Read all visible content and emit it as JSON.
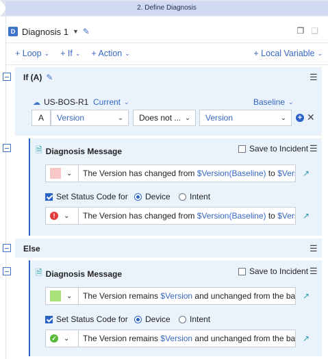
{
  "step": {
    "label": "2. Define Diagnosis"
  },
  "diagnosis": {
    "badge": "D",
    "title": "Diagnosis 1"
  },
  "toolbar": {
    "loop": "+ Loop",
    "if": "+ If",
    "action": "+ Action",
    "local_variable": "+ Local Variable"
  },
  "if_block": {
    "title": "If (A)",
    "device": "US-BOS-R1",
    "current": "Current",
    "baseline": "Baseline",
    "condition": {
      "letter": "A",
      "variable": "Version",
      "operator": "Does not ...",
      "value": "Version"
    }
  },
  "msg1": {
    "title": "Diagnosis Message",
    "save_to_incident": "Save to Incident",
    "color": "#f8c8c8",
    "text_prefix": "The Version has changed from ",
    "var1": "$Version(Baseline)",
    "mid": " to ",
    "var2": "$Version",
    "set_status": "Set Status Code for",
    "device": "Device",
    "intent": "Intent",
    "status_icon": "error-icon",
    "status_color": "#e23b3b"
  },
  "else_block": {
    "title": "Else"
  },
  "msg2": {
    "title": "Diagnosis Message",
    "save_to_incident": "Save to Incident",
    "color": "#a8e07a",
    "text_prefix": "The Version remains ",
    "var1": "$Version",
    "suffix": " and unchanged from the baseli",
    "set_status": "Set Status Code for",
    "device": "Device",
    "intent": "Intent",
    "status_icon": "success-icon",
    "status_color": "#58b83c"
  }
}
